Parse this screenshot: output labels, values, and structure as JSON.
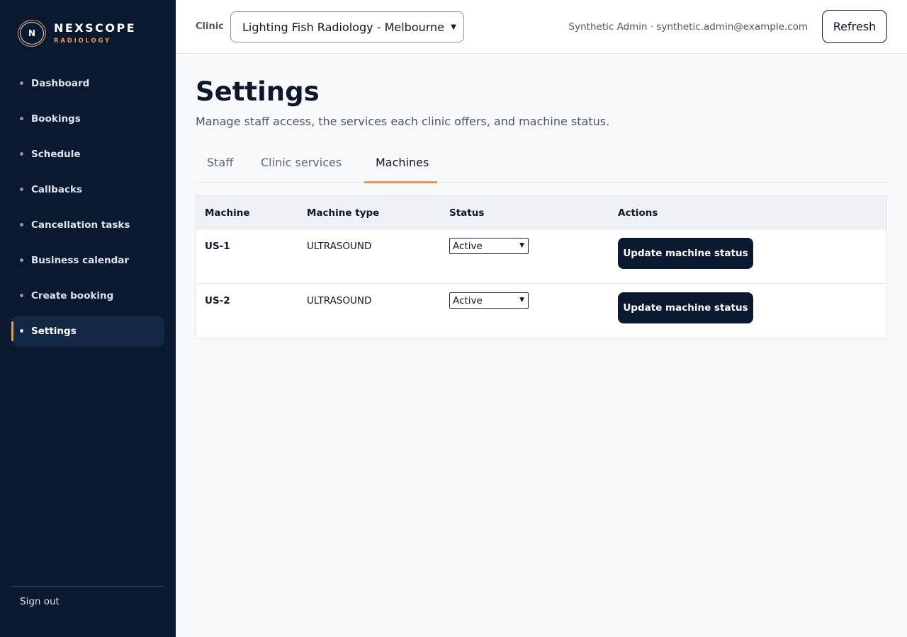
{
  "brand": {
    "name": "NEXSCOPE",
    "sub": "RADIOLOGY",
    "logo_letter": "N",
    "accent": "#e89a4b"
  },
  "sidebar": {
    "items": [
      {
        "label": "Dashboard"
      },
      {
        "label": "Bookings"
      },
      {
        "label": "Schedule"
      },
      {
        "label": "Callbacks"
      },
      {
        "label": "Cancellation tasks"
      },
      {
        "label": "Business calendar"
      },
      {
        "label": "Create booking"
      },
      {
        "label": "Settings",
        "active": true
      }
    ],
    "signout": "Sign out"
  },
  "header": {
    "clinic_label": "Clinic",
    "clinic_selected": "Lighting Fish Radiology - Melbourne",
    "user": "Synthetic Admin · synthetic.admin@example.com",
    "refresh": "Refresh"
  },
  "page": {
    "title": "Settings",
    "description": "Manage staff access, the services each clinic offers, and machine status."
  },
  "tabs": [
    {
      "label": "Staff"
    },
    {
      "label": "Clinic services"
    },
    {
      "label": "Machines",
      "active": true
    }
  ],
  "table": {
    "headers": [
      "Machine",
      "Machine type",
      "Status",
      "Actions"
    ],
    "rows": [
      {
        "machine": "US-1",
        "type": "ULTRASOUND",
        "status": "Active",
        "action": "Update machine status"
      },
      {
        "machine": "US-2",
        "type": "ULTRASOUND",
        "status": "Active",
        "action": "Update machine status"
      }
    ]
  }
}
